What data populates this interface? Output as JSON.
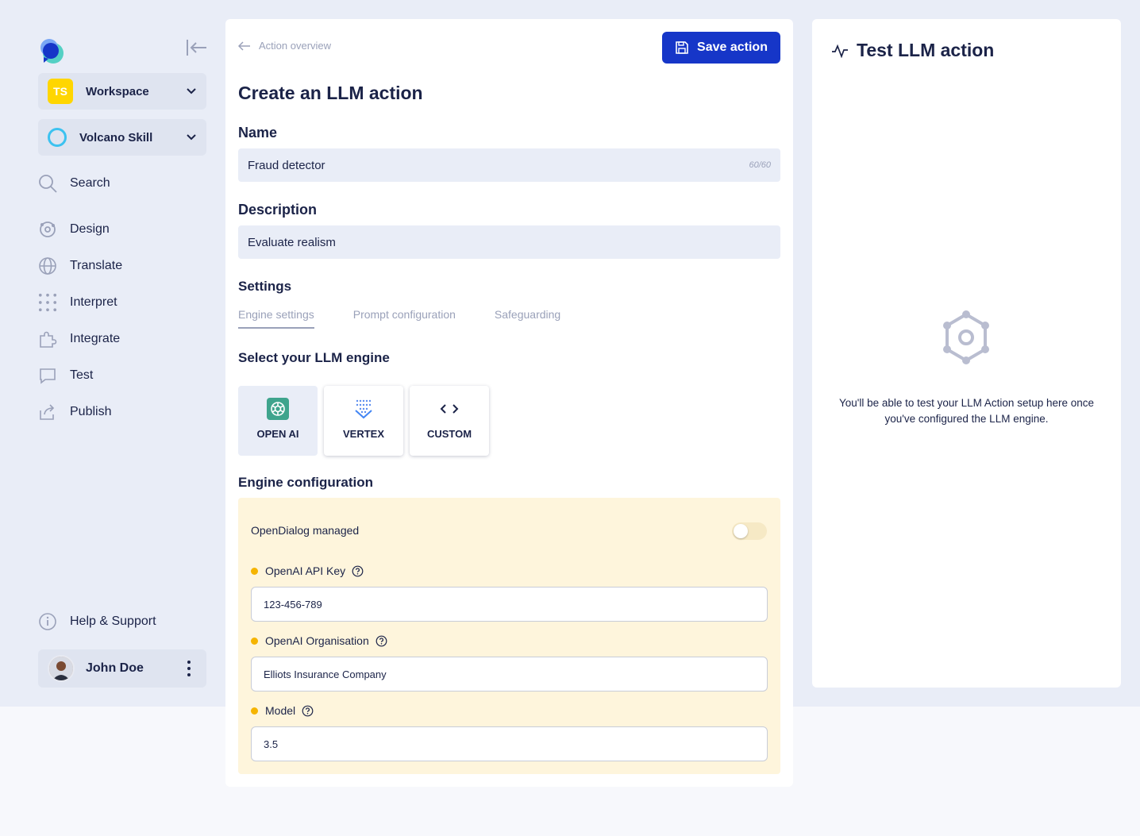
{
  "sidebar": {
    "workspace": {
      "badge": "TS",
      "label": "Workspace"
    },
    "skill": {
      "label": "Volcano Skill"
    },
    "nav": [
      {
        "label": "Search",
        "icon": "search-icon"
      },
      {
        "label": "Design",
        "icon": "design-icon"
      },
      {
        "label": "Translate",
        "icon": "globe-icon"
      },
      {
        "label": "Interpret",
        "icon": "dots-grid-icon"
      },
      {
        "label": "Integrate",
        "icon": "puzzle-icon"
      },
      {
        "label": "Test",
        "icon": "chat-icon"
      },
      {
        "label": "Publish",
        "icon": "share-icon"
      }
    ],
    "help": {
      "label": "Help & Support",
      "icon": "info-icon"
    },
    "user": {
      "name": "John Doe"
    }
  },
  "main": {
    "back_label": "Action overview",
    "save_label": "Save action",
    "title": "Create an LLM action",
    "name_heading": "Name",
    "name_value": "Fraud detector",
    "name_counter": "60/60",
    "description_heading": "Description",
    "description_value": "Evaluate realism",
    "settings_heading": "Settings",
    "tabs": [
      {
        "label": "Engine settings",
        "active": true
      },
      {
        "label": "Prompt configuration",
        "active": false
      },
      {
        "label": "Safeguarding",
        "active": false
      }
    ],
    "engine_heading": "Select your LLM engine",
    "engines": [
      {
        "label": "OPEN AI",
        "icon": "openai-icon",
        "selected": true
      },
      {
        "label": "VERTEX",
        "icon": "vertex-icon",
        "selected": false
      },
      {
        "label": "CUSTOM",
        "icon": "code-icon",
        "selected": false
      }
    ],
    "config_heading": "Engine configuration",
    "config": {
      "managed_label": "OpenDialog managed",
      "managed_enabled": false,
      "api_key_label": "OpenAI API Key",
      "api_key_value": "123-456-789",
      "org_label": "OpenAI Organisation",
      "org_value": "Elliots Insurance Company",
      "model_label": "Model",
      "model_value": "3.5"
    }
  },
  "right_panel": {
    "title": "Test LLM action",
    "empty_message": "You'll be able to test your LLM Action setup here once you've configured the LLM engine."
  },
  "colors": {
    "primary": "#1636c8",
    "text": "#1b2348",
    "muted": "#9aa1b9",
    "config_bg": "#fef5dc",
    "required_dot": "#f5b400",
    "workspace_badge": "#ffd600"
  }
}
